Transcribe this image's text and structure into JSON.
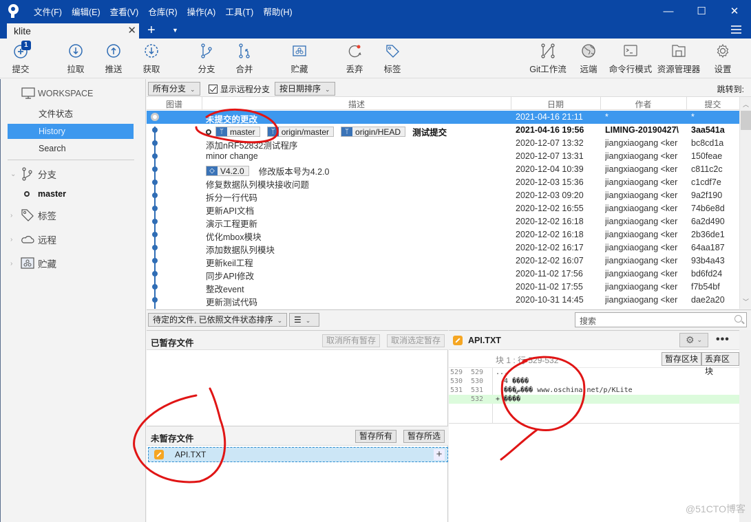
{
  "window": {
    "menu": [
      "文件(F)",
      "编辑(E)",
      "查看(V)",
      "仓库(R)",
      "操作(A)",
      "工具(T)",
      "帮助(H)"
    ],
    "controls": {
      "minimize": "—",
      "maximize": "☐",
      "close": "✕"
    }
  },
  "tabs": {
    "active": "klite",
    "close": "✕",
    "add": "+",
    "dropdown": "▼"
  },
  "toolbar": {
    "commit": {
      "label": "提交",
      "badge": "1"
    },
    "pull": {
      "label": "拉取"
    },
    "push": {
      "label": "推送"
    },
    "fetch": {
      "label": "获取"
    },
    "branch": {
      "label": "分支"
    },
    "merge": {
      "label": "合并"
    },
    "stash": {
      "label": "贮藏"
    },
    "discard": {
      "label": "丢弃"
    },
    "tag": {
      "label": "标签"
    },
    "gitflow": {
      "label": "Git工作流"
    },
    "remote": {
      "label": "远端"
    },
    "terminal": {
      "label": "命令行模式"
    },
    "explorer": {
      "label": "资源管理器"
    },
    "settings": {
      "label": "设置"
    }
  },
  "sidebar": {
    "workspace": "WORKSPACE",
    "items": [
      {
        "label": "文件状态",
        "active": false
      },
      {
        "label": "History",
        "active": true
      },
      {
        "label": "Search",
        "active": false
      }
    ],
    "groups": {
      "branches": "分支",
      "tags": "标签",
      "remotes": "远程",
      "stashes": "贮藏"
    },
    "current_branch": "master"
  },
  "filter": {
    "branches": "所有分支",
    "show_remote": "显示远程分支",
    "show_remote_checked": true,
    "sort": "按日期排序",
    "jump_to": "跳转到:"
  },
  "history": {
    "columns": {
      "graph": "图谱",
      "description": "描述",
      "date": "日期",
      "author": "作者",
      "commit": "提交"
    },
    "rows": [
      {
        "desc": "未提交的更改",
        "date": "2021-04-16 21:11",
        "author": "*",
        "commit": "*",
        "selected": true
      },
      {
        "desc": "测试提交",
        "refs": [
          "master",
          "origin/master",
          "origin/HEAD"
        ],
        "date": "2021-04-16 19:56",
        "author": "LIMING-20190427\\",
        "commit": "3aa541a",
        "bold": true
      },
      {
        "desc": "添加nRF52832测试程序",
        "date": "2020-12-07 13:32",
        "author": "jiangxiaogang <ker",
        "commit": "bc8cd1a"
      },
      {
        "desc": "minor change",
        "date": "2020-12-07 13:31",
        "author": "jiangxiaogang <ker",
        "commit": "150feae"
      },
      {
        "desc": "修改版本号为4.2.0",
        "tag": "V4.2.0",
        "date": "2020-12-04 10:39",
        "author": "jiangxiaogang <ker",
        "commit": "c811c2c"
      },
      {
        "desc": "修复数据队列模块接收问题",
        "date": "2020-12-03 15:36",
        "author": "jiangxiaogang <ker",
        "commit": "c1cdf7e"
      },
      {
        "desc": "拆分一行代码",
        "date": "2020-12-03 09:20",
        "author": "jiangxiaogang <ker",
        "commit": "9a2f190"
      },
      {
        "desc": "更新API文档",
        "date": "2020-12-02 16:55",
        "author": "jiangxiaogang <ker",
        "commit": "74b6e8d"
      },
      {
        "desc": "演示工程更新",
        "date": "2020-12-02 16:18",
        "author": "jiangxiaogang <ker",
        "commit": "6a2d490"
      },
      {
        "desc": "优化mbox模块",
        "date": "2020-12-02 16:18",
        "author": "jiangxiaogang <ker",
        "commit": "2b36de1"
      },
      {
        "desc": "添加数据队列模块",
        "date": "2020-12-02 16:17",
        "author": "jiangxiaogang <ker",
        "commit": "64aa187"
      },
      {
        "desc": "更新keil工程",
        "date": "2020-12-02 16:07",
        "author": "jiangxiaogang <ker",
        "commit": "93b4a43"
      },
      {
        "desc": "同步API修改",
        "date": "2020-11-02 17:56",
        "author": "jiangxiaogang <ker",
        "commit": "bd6fd24"
      },
      {
        "desc": "整改event",
        "date": "2020-11-02 17:55",
        "author": "jiangxiaogang <ker",
        "commit": "f7b54bf"
      },
      {
        "desc": "更新测试代码",
        "date": "2020-10-31 14:45",
        "author": "jiangxiaogang <ker",
        "commit": "dae2a20"
      }
    ]
  },
  "pending": {
    "sort": "待定的文件, 已依照文件状态排序",
    "view": "☰",
    "search_placeholder": "搜索",
    "staged_title": "已暂存文件",
    "unstage_all": "取消所有暂存",
    "unstage_selected": "取消选定暂存",
    "unstaged_title": "未暂存文件",
    "stage_all": "暂存所有",
    "stage_selected": "暂存所选",
    "unstaged_files": [
      {
        "name": "API.TXT",
        "status": "modified"
      }
    ]
  },
  "diff": {
    "file": "API.TXT",
    "hunk_label": "块 1 : 行 529-532",
    "stage_hunk": "暂存区块",
    "discard_hunk": "丢弃区块",
    "more": "•••",
    "lines": [
      {
        "old": "529",
        "new": "529",
        "text": "...",
        "type": "context"
      },
      {
        "old": "530",
        "new": "530",
        "text": "  4 ����",
        "type": "context"
      },
      {
        "old": "531",
        "new": "531",
        "text": "  ���ص��� www.oschina.net/p/KLite",
        "type": "context"
      },
      {
        "old": "",
        "new": "532",
        "text": "+ ����",
        "type": "add"
      }
    ]
  },
  "watermark": "@51CTO博客"
}
